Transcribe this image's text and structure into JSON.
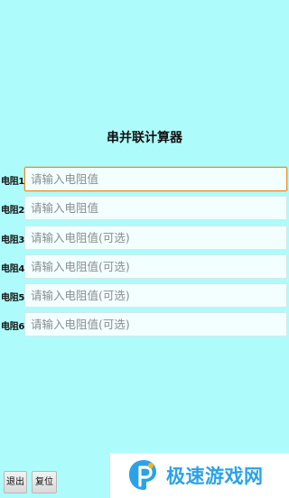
{
  "title": "串并联计算器",
  "rows": [
    {
      "label": "电阻1:",
      "placeholder": "请输入电阻值",
      "value": "",
      "focused": true
    },
    {
      "label": "电阻2:",
      "placeholder": "请输入电阻值",
      "value": ""
    },
    {
      "label": "电阻3:",
      "placeholder": "请输入电阻值(可选)",
      "value": ""
    },
    {
      "label": "电阻4:",
      "placeholder": "请输入电阻值(可选)",
      "value": ""
    },
    {
      "label": "电阻5:",
      "placeholder": "请输入电阻值(可选)",
      "value": ""
    },
    {
      "label": "电阻6:",
      "placeholder": "请输入电阻值(可选)",
      "value": ""
    }
  ],
  "buttons": {
    "exit": "退出",
    "reset": "复位"
  },
  "watermark": {
    "text": "极速游戏网",
    "logo_icon": "p-logo-icon"
  },
  "colors": {
    "background": "#adfcfb",
    "focus_border": "#f08c1c",
    "watermark_text": "#2ba2e6"
  }
}
